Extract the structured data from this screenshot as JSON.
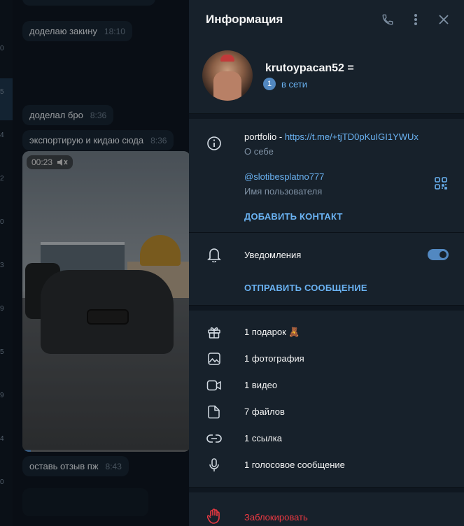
{
  "chat": {
    "messages": [
      {
        "text": "доделаю закину",
        "time": "18:10"
      },
      {
        "text": "доделал бро",
        "time": "8:36"
      },
      {
        "text": "экспортирую и кидаю сюда",
        "time": "8:36"
      },
      {
        "text": "оставь отзыв пж",
        "time": "8:43"
      }
    ],
    "video": {
      "duration": "00:23",
      "progress": 0.05
    }
  },
  "left_strip": [
    "0",
    "5",
    "4",
    "2",
    "0",
    "3",
    "9",
    "5",
    "9",
    "4",
    "0"
  ],
  "panel": {
    "title": "Информация",
    "icons": {
      "call": "phone-icon",
      "more": "more-vertical-icon",
      "close": "close-icon"
    },
    "profile": {
      "name": "krutoypacan52 =",
      "badge_count": "1",
      "status": "в сети"
    },
    "bio": {
      "prefix": "portfolio - ",
      "link": "https://t.me/+tjTD0pKuIGI1YWUx",
      "label": "О себе"
    },
    "username": {
      "value": "@slotibesplatno777",
      "label": "Имя пользователя"
    },
    "add_contact": "ДОБАВИТЬ КОНТАКТ",
    "notifications": {
      "label": "Уведомления",
      "enabled": true
    },
    "send_message": "ОТПРАВИТЬ СООБЩЕНИЕ",
    "media": [
      {
        "icon": "gift-icon",
        "label": "1 подарок"
      },
      {
        "icon": "photo-icon",
        "label": "1 фотография"
      },
      {
        "icon": "video-icon",
        "label": "1 видео"
      },
      {
        "icon": "file-icon",
        "label": "7 файлов"
      },
      {
        "icon": "link-icon",
        "label": "1 ссылка"
      },
      {
        "icon": "mic-icon",
        "label": "1 голосовое сообщение"
      }
    ],
    "gift_emoji": "🧸",
    "block": "Заблокировать"
  },
  "colors": {
    "accent": "#6ab2f2",
    "danger": "#ec3942",
    "panel_bg": "#17212b",
    "chat_bg": "#0e1621"
  }
}
